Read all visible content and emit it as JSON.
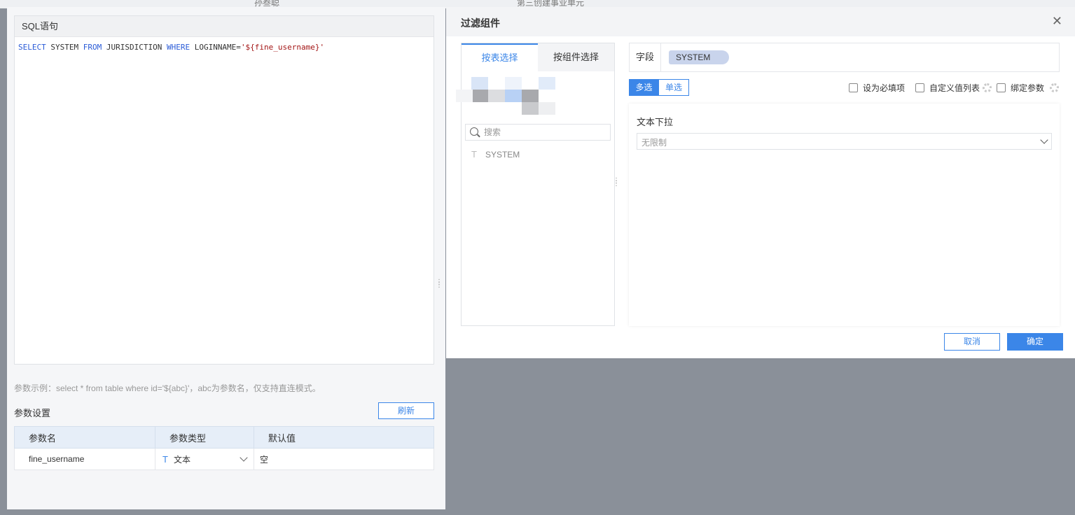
{
  "background": {
    "top_labels": [
      "孙叁聪",
      "第三创建事业单元"
    ]
  },
  "sql_panel": {
    "title": "SQL语句",
    "code": {
      "select_kw": "SELECT",
      "field": " SYSTEM ",
      "from_kw": "FROM",
      "table": " JURISDICTION ",
      "where_kw": "WHERE",
      "cond": " LOGINNAME=",
      "value": "'${fine_username}'"
    }
  },
  "hint_text": "参数示例：select * from table where id='${abc}'，abc为参数名，仅支持直连模式。",
  "params": {
    "title": "参数设置",
    "refresh_label": "刷新",
    "headers": [
      "参数名",
      "参数类型",
      "默认值"
    ],
    "rows": [
      {
        "name": "fine_username",
        "type": "文本",
        "default_placeholder": "空"
      }
    ]
  },
  "dialog": {
    "title": "过滤组件",
    "close_icon": "close-icon",
    "tabs": [
      "按表选择",
      "按组件选择"
    ],
    "active_tab": 0,
    "search_placeholder": "搜索",
    "fields": [
      {
        "type_icon": "T",
        "name": "SYSTEM"
      }
    ],
    "field_label": "字段",
    "field_value": "SYSTEM",
    "mode_multi": "多选",
    "mode_single": "单选",
    "checkbox_required": "设为必填项",
    "checkbox_custom_list": "自定义值列表",
    "checkbox_bind_param": "绑定参数",
    "preview_label": "文本下拉",
    "select_value": "无限制",
    "cancel_label": "取消",
    "ok_label": "确定"
  },
  "colors": {
    "accent": "#3b86e8",
    "overlay": "#8a9099"
  }
}
